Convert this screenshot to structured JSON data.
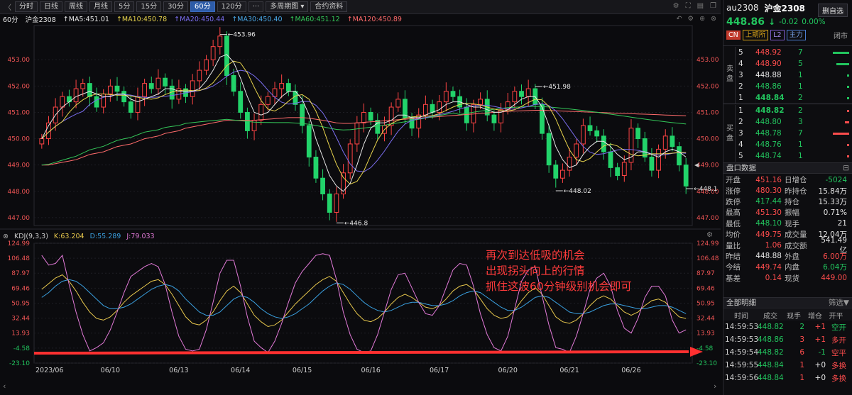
{
  "toolbar": {
    "buttons": [
      "分时",
      "日线",
      "周线",
      "月线",
      "5分",
      "15分",
      "30分",
      "60分",
      "120分",
      "···",
      "多周期图",
      "合约资料"
    ],
    "active": "60分"
  },
  "ma_legend": {
    "period": "60分",
    "symbol": "沪金2308",
    "items": [
      {
        "label": "MA",
        "value": "MA5:451.01",
        "color": "#e8e8e8"
      },
      {
        "label": "MA10",
        "value": "MA10:450.78",
        "color": "#e8d44d"
      },
      {
        "label": "MA20",
        "value": "MA20:450.44",
        "color": "#7b6ef0"
      },
      {
        "label": "MA30",
        "value": "MA30:450.40",
        "color": "#4aa8e8"
      },
      {
        "label": "MA60",
        "value": "MA60:451.12",
        "color": "#34c759"
      },
      {
        "label": "MA120",
        "value": "MA120:450.89",
        "color": "#ff6b6b"
      }
    ]
  },
  "kdj_legend": {
    "name": "KDJ(9,3,3)",
    "k": "K:63.204",
    "d": "D:55.289",
    "j": "J:79.033"
  },
  "annotation": [
    "再次到达低吸的机会",
    "出现拐头向上的行情",
    "抓住这波60分钟级别机会即可"
  ],
  "chart_data": [
    {
      "type": "candlestick",
      "title": "",
      "ylim": [
        446.7,
        454.3
      ],
      "yticks": [
        447.0,
        448.0,
        449.0,
        450.0,
        451.0,
        452.0,
        453.0
      ],
      "ytick_labels": [
        "447.00",
        "448.00",
        "449.00",
        "450.00",
        "451.00",
        "452.00",
        "453.00"
      ],
      "xtick_labels": [
        "2023/06",
        "06/10",
        "06/13",
        "06/14",
        "06/15",
        "06/16",
        "06/17",
        "06/20",
        "06/21",
        "06/26"
      ],
      "markers": [
        {
          "label": "453.96",
          "value": 453.96
        },
        {
          "label": "451.98",
          "value": 451.98
        },
        {
          "label": "446.8",
          "value": 446.8
        },
        {
          "label": "448.02",
          "value": 448.02
        },
        {
          "label": "448.1",
          "value": 448.1
        }
      ],
      "closes": [
        450.0,
        450.6,
        451.2,
        451.6,
        451.4,
        451.9,
        452.1,
        451.6,
        451.2,
        451.7,
        452.0,
        451.8,
        451.4,
        451.0,
        451.6,
        452.1,
        451.9,
        452.3,
        452.0,
        451.5,
        451.9,
        451.6,
        452.2,
        452.6,
        453.0,
        453.5,
        453.9,
        452.4,
        451.8,
        451.0,
        450.3,
        450.7,
        451.3,
        451.6,
        451.9,
        452.1,
        451.8,
        451.3,
        450.5,
        449.3,
        448.5,
        447.9,
        447.2,
        447.9,
        448.7,
        449.8,
        450.6,
        451.0,
        450.7,
        450.2,
        450.5,
        451.2,
        451.5,
        450.8,
        450.4,
        450.9,
        451.3,
        451.0,
        451.4,
        451.8,
        451.6,
        451.2,
        450.6,
        451.3,
        451.5,
        450.9,
        450.6,
        451.1,
        451.4,
        451.8,
        451.6,
        451.9,
        451.3,
        450.2,
        449.0,
        448.5,
        448.8,
        449.3,
        449.8,
        450.5,
        450.3,
        450.1,
        449.5,
        448.9,
        448.6,
        449.1,
        450.4,
        450.0,
        449.3,
        448.8,
        449.6,
        450.1,
        449.7,
        449.0,
        448.2
      ],
      "opens": [
        449.8,
        450.0,
        450.6,
        451.2,
        451.6,
        451.4,
        451.9,
        452.1,
        451.6,
        451.2,
        451.7,
        452.0,
        451.8,
        451.4,
        451.0,
        451.6,
        452.1,
        451.9,
        452.3,
        452.0,
        451.5,
        451.9,
        451.6,
        452.2,
        452.6,
        453.0,
        453.5,
        453.9,
        452.4,
        451.8,
        451.0,
        450.3,
        450.7,
        451.3,
        451.6,
        451.9,
        452.1,
        451.8,
        451.3,
        450.5,
        449.3,
        448.5,
        447.9,
        447.2,
        447.9,
        448.7,
        449.8,
        450.6,
        451.0,
        450.7,
        450.2,
        450.5,
        451.2,
        451.5,
        450.8,
        450.4,
        450.9,
        451.3,
        451.0,
        451.4,
        451.8,
        451.6,
        451.2,
        450.6,
        451.3,
        451.5,
        450.9,
        450.6,
        451.1,
        451.4,
        451.8,
        451.6,
        451.9,
        451.3,
        450.2,
        449.0,
        448.5,
        448.8,
        449.3,
        449.8,
        450.5,
        450.3,
        450.1,
        449.5,
        448.9,
        448.6,
        449.1,
        450.4,
        450.0,
        449.3,
        448.8,
        449.6,
        450.1,
        449.7,
        449.0
      ],
      "ma5": [
        450.0,
        450.5,
        450.9,
        451.2,
        451.4,
        451.6,
        451.7,
        451.8,
        451.7,
        451.6,
        451.6,
        451.7,
        451.7,
        451.5,
        451.4,
        451.5,
        451.6,
        451.7,
        451.9,
        451.9,
        451.8,
        451.8,
        451.8,
        451.9,
        452.2,
        452.6,
        453.1,
        453.2,
        452.9,
        452.3,
        451.6,
        451.0,
        450.9,
        451.0,
        451.3,
        451.6,
        451.8,
        451.8,
        451.5,
        450.9,
        450.0,
        449.3,
        448.6,
        448.2,
        448.0,
        448.3,
        449.0,
        449.8,
        450.4,
        450.6,
        450.6,
        450.7,
        450.9,
        450.9,
        450.8,
        450.8,
        450.9,
        451.0,
        451.1,
        451.3,
        451.4,
        451.4,
        451.3,
        451.2,
        451.2,
        451.1,
        451.0,
        451.0,
        451.1,
        451.3,
        451.5,
        451.6,
        451.6,
        451.2,
        450.5,
        449.7,
        449.2,
        448.9,
        449.0,
        449.4,
        449.7,
        449.9,
        449.9,
        449.7,
        449.4,
        449.2,
        449.3,
        449.5,
        449.5,
        449.4,
        449.3,
        449.5,
        449.6,
        449.5,
        449.3
      ],
      "ma_long": [
        449.0,
        449.0,
        449.05,
        449.1,
        449.15,
        449.2,
        449.3,
        449.4,
        449.45,
        449.5,
        449.6,
        449.7,
        449.75,
        449.8,
        449.9,
        450.0,
        450.05,
        450.1,
        450.2,
        450.25,
        450.3,
        450.4,
        450.45,
        450.5,
        450.55,
        450.6,
        450.65,
        450.7,
        450.7,
        450.7,
        450.7,
        450.7,
        450.72,
        450.74,
        450.76,
        450.78,
        450.8,
        450.8,
        450.8,
        450.78,
        450.74,
        450.7,
        450.65,
        450.6,
        450.58,
        450.58,
        450.6,
        450.62,
        450.64,
        450.66,
        450.68,
        450.7,
        450.72,
        450.74,
        450.76,
        450.78,
        450.8,
        450.82,
        450.84,
        450.86,
        450.88,
        450.9,
        450.92,
        450.94,
        450.96,
        450.98,
        451.0,
        451.02,
        451.04,
        451.05,
        451.06,
        451.07,
        451.08,
        451.08,
        451.07,
        451.06,
        451.05,
        451.04,
        451.03,
        451.02,
        451.01,
        451.0,
        450.99,
        450.98,
        450.97,
        450.96,
        450.95,
        450.94,
        450.93,
        450.92,
        450.91,
        450.9,
        450.89,
        450.88,
        450.87
      ]
    },
    {
      "type": "line",
      "title": "",
      "ylim": [
        -23.1,
        124.99
      ],
      "yticks": [
        124.99,
        106.48,
        87.97,
        69.46,
        50.95,
        32.44,
        13.93,
        -4.58,
        -23.1
      ],
      "ytick_labels": [
        "124.99",
        "106.48",
        "87.97",
        "69.46",
        "50.95",
        "32.44",
        "13.93",
        "-4.58",
        "-23.10"
      ],
      "series": [
        {
          "name": "K",
          "color": "#e8c84d",
          "values": [
            68,
            75,
            82,
            86,
            78,
            66,
            52,
            40,
            32,
            30,
            34,
            42,
            52,
            60,
            66,
            72,
            78,
            80,
            74,
            62,
            48,
            34,
            26,
            24,
            30,
            40,
            54,
            66,
            72,
            64,
            50,
            36,
            28,
            22,
            24,
            30,
            40,
            50,
            58,
            66,
            74,
            80,
            84,
            78,
            64,
            50,
            38,
            30,
            28,
            32,
            40,
            50,
            58,
            62,
            58,
            52,
            46,
            44,
            48,
            56,
            66,
            72,
            74,
            68,
            56,
            44,
            36,
            32,
            34,
            42,
            54,
            64,
            70,
            62,
            48,
            34,
            28,
            26,
            30,
            38,
            48,
            56,
            60,
            56,
            48,
            40,
            36,
            40,
            48,
            54,
            56,
            52,
            42,
            34,
            32
          ]
        },
        {
          "name": "D",
          "color": "#3aa0e0",
          "values": [
            58,
            64,
            72,
            78,
            80,
            78,
            72,
            64,
            56,
            48,
            44,
            44,
            46,
            50,
            56,
            62,
            68,
            72,
            74,
            72,
            66,
            56,
            48,
            40,
            36,
            36,
            40,
            48,
            56,
            60,
            58,
            52,
            44,
            38,
            34,
            32,
            34,
            38,
            44,
            50,
            58,
            66,
            72,
            76,
            74,
            68,
            60,
            52,
            46,
            42,
            40,
            42,
            46,
            50,
            52,
            52,
            50,
            48,
            48,
            50,
            54,
            60,
            64,
            66,
            64,
            58,
            52,
            46,
            42,
            42,
            46,
            52,
            58,
            60,
            58,
            52,
            46,
            40,
            38,
            38,
            40,
            44,
            48,
            50,
            50,
            48,
            46,
            44,
            44,
            46,
            48,
            48,
            46,
            42,
            38
          ]
        },
        {
          "name": "J",
          "color": "#e27ad8",
          "values": [
            110,
            98,
            100,
            110,
            74,
            40,
            12,
            -8,
            -4,
            2,
            18,
            40,
            64,
            84,
            90,
            96,
            100,
            96,
            74,
            40,
            10,
            -6,
            -8,
            -6,
            18,
            52,
            88,
            104,
            104,
            72,
            34,
            4,
            -4,
            -10,
            4,
            26,
            52,
            76,
            90,
            100,
            110,
            112,
            110,
            80,
            40,
            12,
            -6,
            -10,
            -8,
            12,
            40,
            68,
            86,
            88,
            70,
            52,
            38,
            36,
            48,
            70,
            92,
            100,
            98,
            72,
            38,
            12,
            -4,
            -8,
            10,
            44,
            78,
            92,
            96,
            60,
            24,
            -4,
            -6,
            -10,
            10,
            38,
            68,
            82,
            88,
            72,
            42,
            20,
            14,
            32,
            58,
            72,
            72,
            60,
            30,
            14,
            18
          ]
        }
      ],
      "xtick_labels": [
        "2023/06",
        "06/10",
        "06/13",
        "06/14",
        "06/15",
        "06/16",
        "06/17",
        "06/20",
        "06/21",
        "06/26"
      ]
    }
  ],
  "quote": {
    "code": "au2308",
    "name": "沪金2308",
    "close_btn": "删自选",
    "price": "448.86",
    "arrow": "↓",
    "change": "-0.02",
    "pct": "0.00%",
    "tags": [
      "CN",
      "上期所",
      "L2",
      "主力"
    ],
    "status": "闭市"
  },
  "orderbook": {
    "sell_label": "卖盘",
    "buy_label": "买盘",
    "asks": [
      {
        "lvl": "5",
        "price": "448.92",
        "qty": "7",
        "bar": 0.9,
        "pcolor": "#ff4d4d"
      },
      {
        "lvl": "4",
        "price": "448.90",
        "qty": "5",
        "bar": 0.7,
        "pcolor": "#ff4d4d"
      },
      {
        "lvl": "3",
        "price": "448.88",
        "qty": "1",
        "bar": 0.08,
        "pcolor": "#e6e6e6"
      },
      {
        "lvl": "2",
        "price": "448.86",
        "qty": "1",
        "bar": 0.08,
        "pcolor": "#22c55e"
      },
      {
        "lvl": "1",
        "price": "448.84",
        "qty": "2",
        "bar": 0.12,
        "pcolor": "#22c55e"
      }
    ],
    "bids": [
      {
        "lvl": "1",
        "price": "448.82",
        "qty": "2",
        "bar": 0.12,
        "pcolor": "#22c55e"
      },
      {
        "lvl": "2",
        "price": "448.80",
        "qty": "3",
        "bar": 0.22,
        "pcolor": "#22c55e"
      },
      {
        "lvl": "3",
        "price": "448.78",
        "qty": "7",
        "bar": 0.9,
        "pcolor": "#22c55e"
      },
      {
        "lvl": "4",
        "price": "448.76",
        "qty": "1",
        "bar": 0.08,
        "pcolor": "#22c55e"
      },
      {
        "lvl": "5",
        "price": "448.74",
        "qty": "1",
        "bar": 0.08,
        "pcolor": "#22c55e"
      }
    ]
  },
  "stats_title": "盘口数据",
  "stats": [
    {
      "k": "开盘",
      "v": "451.16",
      "vc": "#ff4d4d",
      "k2": "日增仓",
      "v2": "-5024",
      "v2c": "#22c55e"
    },
    {
      "k": "涨停",
      "v": "480.30",
      "vc": "#ff4d4d",
      "k2": "昨持仓",
      "v2": "15.84万",
      "v2c": "#e6e6e6"
    },
    {
      "k": "跌停",
      "v": "417.44",
      "vc": "#22c55e",
      "k2": "持仓",
      "v2": "15.33万",
      "v2c": "#e6e6e6"
    },
    {
      "k": "最高",
      "v": "451.30",
      "vc": "#ff4d4d",
      "k2": "振幅",
      "v2": "0.71%",
      "v2c": "#e6e6e6"
    },
    {
      "k": "最低",
      "v": "448.10",
      "vc": "#22c55e",
      "k2": "现手",
      "v2": "21",
      "v2c": "#e6e6e6"
    },
    {
      "k": "均价",
      "v": "449.75",
      "vc": "#ff4d4d",
      "k2": "成交量",
      "v2": "12.04万",
      "v2c": "#e6e6e6"
    },
    {
      "k": "量比",
      "v": "1.06",
      "vc": "#ff4d4d",
      "k2": "成交额",
      "v2": "541.49亿",
      "v2c": "#e6e6e6"
    },
    {
      "k": "昨结",
      "v": "448.88",
      "vc": "#e6e6e6",
      "k2": "外盘",
      "v2": "6.00万",
      "v2c": "#ff4d4d"
    },
    {
      "k": "今结",
      "v": "449.74",
      "vc": "#ff4d4d",
      "k2": "内盘",
      "v2": "6.04万",
      "v2c": "#22c55e"
    },
    {
      "k": "基差",
      "v": "0.14",
      "vc": "#ff4d4d",
      "k2": "现货",
      "v2": "449.00",
      "v2c": "#ff4d4d"
    }
  ],
  "ticks_title": "全部明细",
  "ticks_filter": "筛选",
  "ticks_headers": [
    "时间",
    "成交",
    "现手",
    "增仓",
    "开平"
  ],
  "ticks": [
    {
      "t": "14:59:53",
      "p": "448.82",
      "pc": "#22c55e",
      "v": "2",
      "vc": "#22c55e",
      "oi": "+1",
      "oic": "#ff4d4d",
      "ty": "空开",
      "tyc": "#22c55e"
    },
    {
      "t": "14:59:53",
      "p": "448.86",
      "pc": "#22c55e",
      "v": "3",
      "vc": "#ff4d4d",
      "oi": "+1",
      "oic": "#ff4d4d",
      "ty": "多开",
      "tyc": "#ff4d4d"
    },
    {
      "t": "14:59:54",
      "p": "448.82",
      "pc": "#22c55e",
      "v": "6",
      "vc": "#ff4d4d",
      "oi": "-1",
      "oic": "#22c55e",
      "ty": "空平",
      "tyc": "#ff4d4d"
    },
    {
      "t": "14:59:55",
      "p": "448.84",
      "pc": "#22c55e",
      "v": "1",
      "vc": "#ff4d4d",
      "oi": "+0",
      "oic": "#e6e6e6",
      "ty": "多换",
      "tyc": "#ff4d4d"
    },
    {
      "t": "14:59:56",
      "p": "448.84",
      "pc": "#22c55e",
      "v": "1",
      "vc": "#ff4d4d",
      "oi": "+0",
      "oic": "#e6e6e6",
      "ty": "多换",
      "tyc": "#ff4d4d"
    }
  ]
}
